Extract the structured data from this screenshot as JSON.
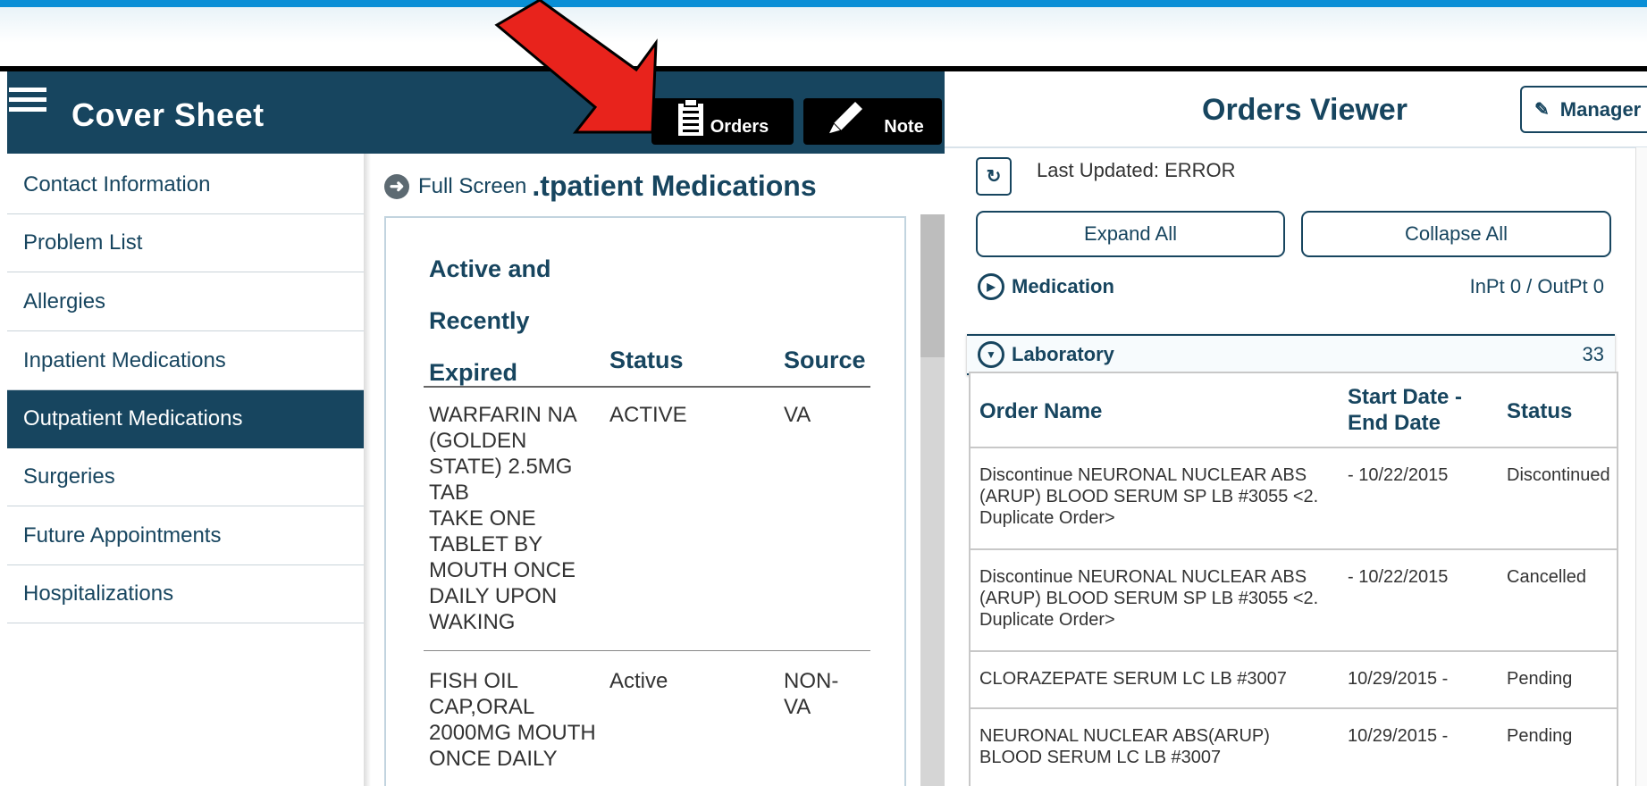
{
  "header": {
    "title": "Cover Sheet",
    "orders_label": "Orders",
    "note_label": "Note"
  },
  "nav": {
    "items": [
      {
        "label": "Contact Information"
      },
      {
        "label": "Problem List"
      },
      {
        "label": "Allergies"
      },
      {
        "label": "Inpatient Medications"
      },
      {
        "label": "Outpatient Medications",
        "active": true
      },
      {
        "label": "Surgeries"
      },
      {
        "label": "Future Appointments"
      },
      {
        "label": "Hospitalizations"
      }
    ]
  },
  "middle": {
    "fullscreen_label": "Full Screen",
    "title": ".tpatient Medications",
    "columns": [
      "Active and\nRecently\nExpired",
      "Status",
      "Source"
    ],
    "rows": [
      {
        "med": "WARFARIN NA\n(GOLDEN\nSTATE) 2.5MG\nTAB\nTAKE ONE\nTABLET BY\nMOUTH ONCE\nDAILY UPON\nWAKING",
        "status": "ACTIVE",
        "source": "VA"
      },
      {
        "med": "FISH OIL\nCAP,ORAL\n2000MG MOUTH\nONCE DAILY",
        "status": "Active",
        "source": "NON-\nVA"
      }
    ]
  },
  "right": {
    "title": "Orders Viewer",
    "manager_label": "Manager",
    "last_updated": "Last Updated: ERROR",
    "expand_label": "Expand All",
    "collapse_label": "Collapse All",
    "groups": [
      {
        "name": "Medication",
        "count": "InPt 0 / OutPt 0",
        "expanded": false
      },
      {
        "name": "Laboratory",
        "count": "33",
        "expanded": true
      }
    ],
    "table": {
      "headers": [
        "Order Name",
        "Start Date -\nEnd Date",
        "Status"
      ],
      "rows": [
        {
          "name": "Discontinue NEURONAL NUCLEAR ABS\n(ARUP) BLOOD SERUM SP LB #3055 <2.\nDuplicate Order>",
          "dates": "- 10/22/2015",
          "status": "Discontinued"
        },
        {
          "name": "Discontinue NEURONAL NUCLEAR ABS\n(ARUP) BLOOD SERUM SP LB #3055 <2.\nDuplicate Order>",
          "dates": "- 10/22/2015",
          "status": "Cancelled"
        },
        {
          "name": "CLORAZEPATE SERUM LC LB #3007",
          "dates": "10/29/2015 -",
          "status": "Pending"
        },
        {
          "name": "NEURONAL NUCLEAR ABS(ARUP)\nBLOOD SERUM LC LB #3007",
          "dates": "10/29/2015 -",
          "status": "Pending"
        }
      ]
    }
  },
  "colors": {
    "header_bg": "#17455f",
    "accent": "#17455f",
    "arrow": "#e8231c",
    "top_strip": "#0a8fd6"
  },
  "icons": [
    "hamburger-icon",
    "clipboard-icon",
    "pencil-icon",
    "back-circle-icon",
    "refresh-icon",
    "play-circle-icon",
    "chevron-down-circle-icon",
    "red-arrow-annotation"
  ]
}
